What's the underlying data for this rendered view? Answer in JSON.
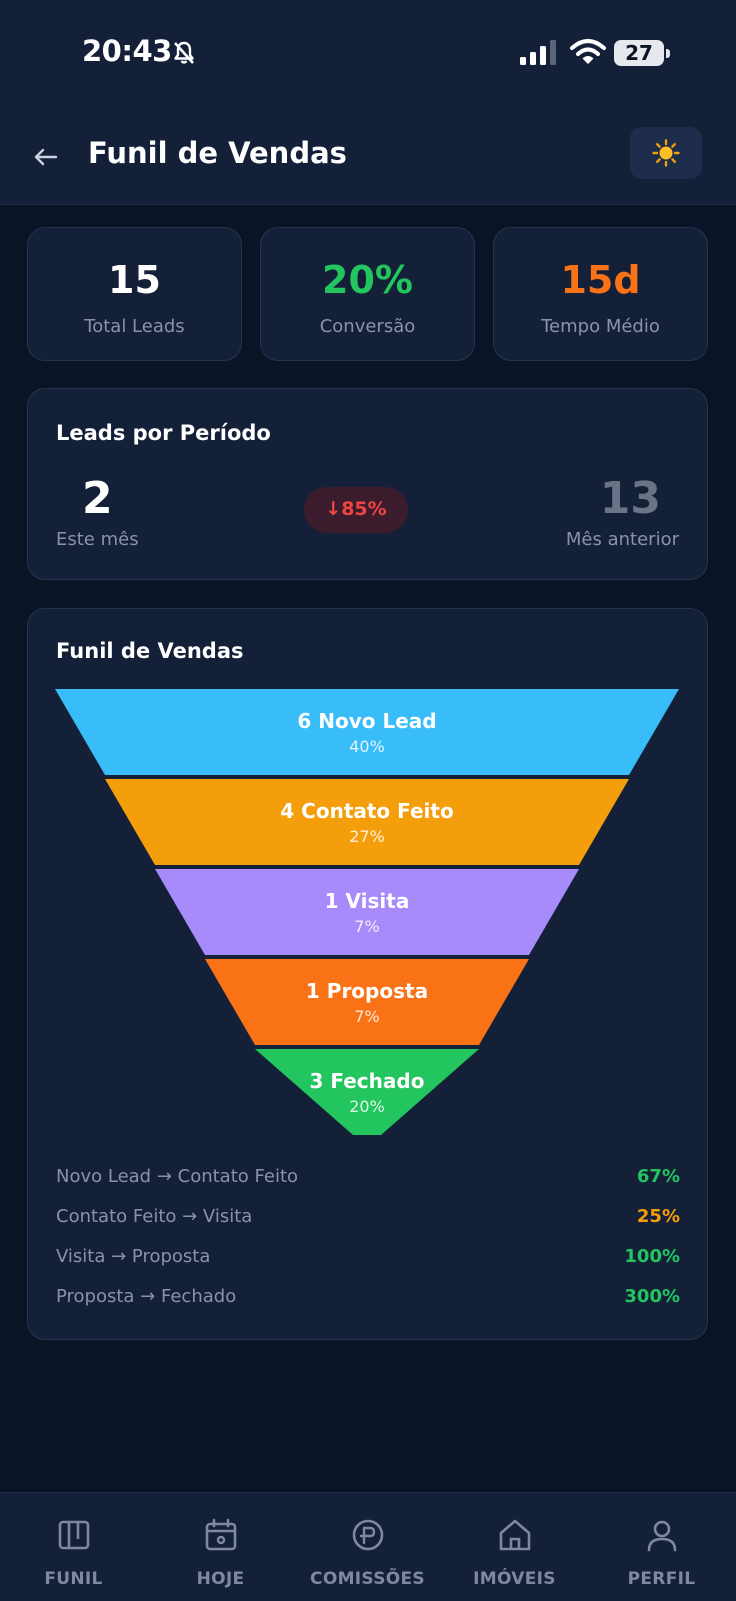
{
  "status_bar": {
    "time": "20:43",
    "battery": "27"
  },
  "header": {
    "title": "Funil de Vendas"
  },
  "stats": [
    {
      "value": "15",
      "label": "Total Leads",
      "color": "#ffffff"
    },
    {
      "value": "20%",
      "label": "Conversão",
      "color": "#22c55e"
    },
    {
      "value": "15d",
      "label": "Tempo Médio",
      "color": "#f97316"
    }
  ],
  "period": {
    "title": "Leads por Período",
    "current_value": "2",
    "current_label": "Este mês",
    "change": "↓85%",
    "previous_value": "13",
    "previous_label": "Mês anterior"
  },
  "funnel": {
    "title": "Funil de Vendas",
    "stages": [
      {
        "label": "6 Novo Lead",
        "percent": "40%",
        "color": "#38bdf8"
      },
      {
        "label": "4 Contato Feito",
        "percent": "27%",
        "color": "#f59e0b"
      },
      {
        "label": "1 Visita",
        "percent": "7%",
        "color": "#a78bfa"
      },
      {
        "label": "1 Proposta",
        "percent": "7%",
        "color": "#f97316"
      },
      {
        "label": "3 Fechado",
        "percent": "20%",
        "color": "#22c55e"
      }
    ],
    "conversions": [
      {
        "label": "Novo Lead → Contato Feito",
        "value": "67%",
        "color": "#22c55e"
      },
      {
        "label": "Contato Feito → Visita",
        "value": "25%",
        "color": "#f59e0b"
      },
      {
        "label": "Visita → Proposta",
        "value": "100%",
        "color": "#22c55e"
      },
      {
        "label": "Proposta → Fechado",
        "value": "300%",
        "color": "#22c55e"
      }
    ]
  },
  "nav": [
    {
      "label": "FUNIL",
      "icon": "kanban-icon"
    },
    {
      "label": "HOJE",
      "icon": "calendar-icon"
    },
    {
      "label": "COMISSÕES",
      "icon": "coin-icon"
    },
    {
      "label": "IMÓVEIS",
      "icon": "home-icon"
    },
    {
      "label": "PERFIL",
      "icon": "user-icon"
    }
  ]
}
